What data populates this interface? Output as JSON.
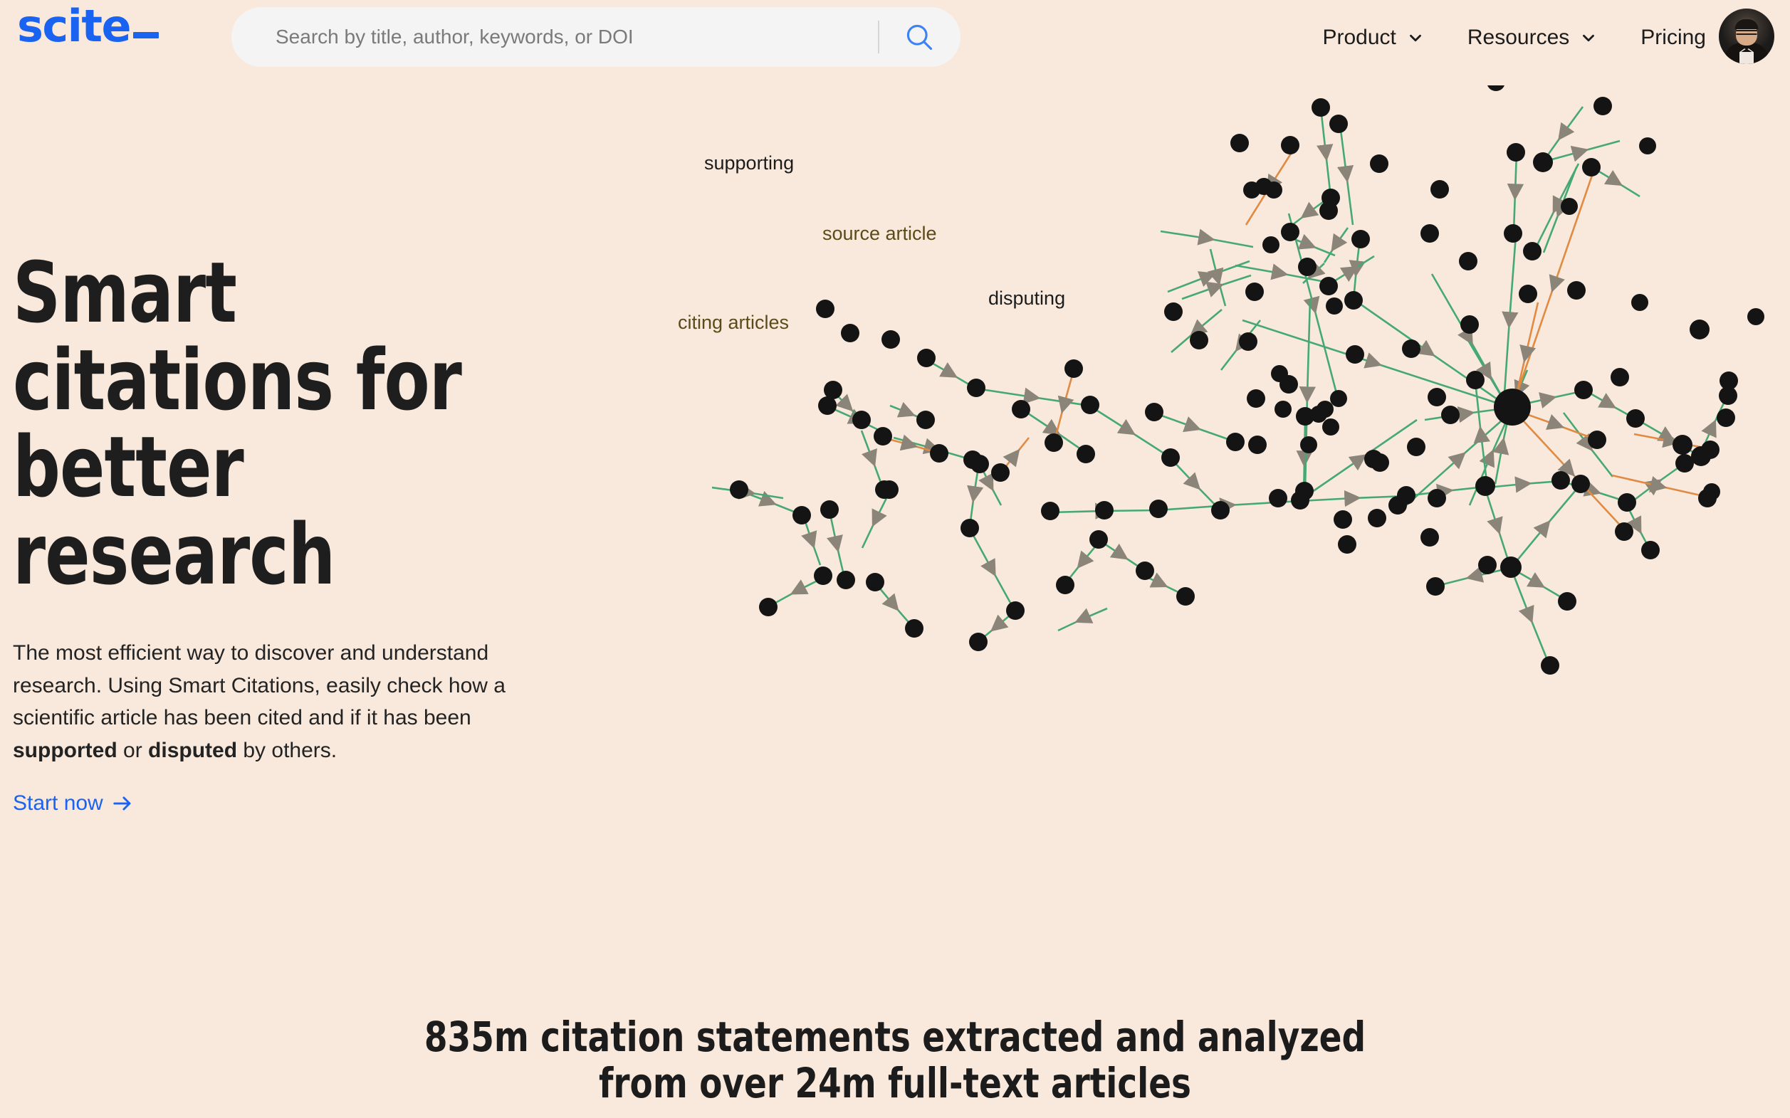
{
  "brand": {
    "name": "scite",
    "cursor_glyph": "_"
  },
  "search": {
    "placeholder": "Search by title, author, keywords, or DOI",
    "value": "",
    "icon": "search-icon"
  },
  "nav": {
    "items": [
      {
        "label": "Product",
        "has_dropdown": true,
        "icon": "chevron-down-icon"
      },
      {
        "label": "Resources",
        "has_dropdown": true,
        "icon": "chevron-down-icon"
      },
      {
        "label": "Pricing",
        "has_dropdown": false,
        "icon": ""
      }
    ],
    "avatar": "user-avatar"
  },
  "hero": {
    "title_line1": "Smart",
    "title_line2": "citations for",
    "title_line3": "better",
    "title_line4": "research",
    "sub_part1": "The most efficient way to discover and understand research. Using Smart Citations, easily check how a scientific article has been cited and if it has been ",
    "sub_bold1": "supported",
    "sub_mid": " or ",
    "sub_bold2": "disputed",
    "sub_part2": " by others.",
    "cta_label": "Start now",
    "cta_arrow": "→"
  },
  "graph": {
    "labels": {
      "supporting": "supporting",
      "source_article": "source article",
      "citing_articles": "citing articles",
      "disputing": "disputing"
    },
    "colors": {
      "supporting_edge": "#46A873",
      "disputing_edge": "#E08A42",
      "node": "#141414",
      "arrow": "#8a8578",
      "label_dark": "#1c1c1c",
      "label_olive": "#5B4B18"
    }
  },
  "stats": {
    "line1": "835m citation statements extracted and analyzed",
    "line2": "from over 24m full-text articles",
    "citation_statements": "835m",
    "full_text_articles": "24m"
  },
  "theme": {
    "background": "#F9E9DC",
    "brand_blue": "#1A63F0",
    "text_dark": "#1E1E1E",
    "search_bg": "#F4F4F4"
  }
}
